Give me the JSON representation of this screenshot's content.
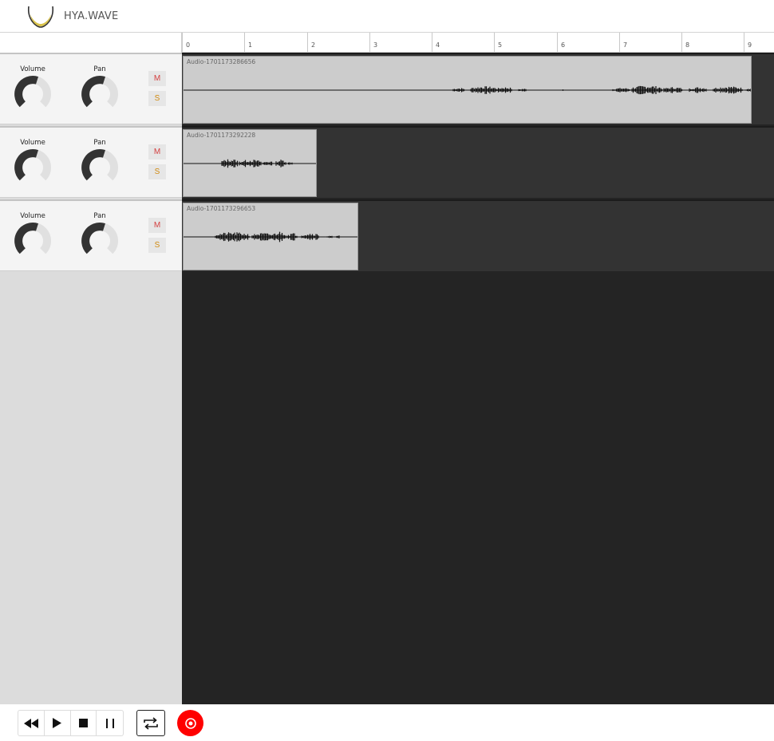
{
  "app": {
    "title": "HYA.WAVE"
  },
  "ruler": {
    "labels": [
      "0",
      "1",
      "2",
      "3",
      "4",
      "5",
      "6",
      "7",
      "8",
      "9"
    ]
  },
  "tracks": [
    {
      "volume_label": "Volume",
      "pan_label": "Pan",
      "mute_label": "M",
      "solo_label": "S",
      "clip_name": "Audio-1701173286656"
    },
    {
      "volume_label": "Volume",
      "pan_label": "Pan",
      "mute_label": "M",
      "solo_label": "S",
      "clip_name": "Audio-1701173292228"
    },
    {
      "volume_label": "Volume",
      "pan_label": "Pan",
      "mute_label": "M",
      "solo_label": "S",
      "clip_name": "Audio-1701173296653"
    }
  ],
  "transport": {
    "icons": [
      "rewind-icon",
      "play-icon",
      "stop-icon",
      "pause-icon",
      "loop-icon",
      "record-icon"
    ]
  },
  "colors": {
    "record": "#ff0000",
    "mute": "#d44040",
    "solo": "#d08a10",
    "clip": "#cccccc",
    "lane": "#333333",
    "timeline_bg": "#242424",
    "logo_gold": "#d8c24a"
  }
}
